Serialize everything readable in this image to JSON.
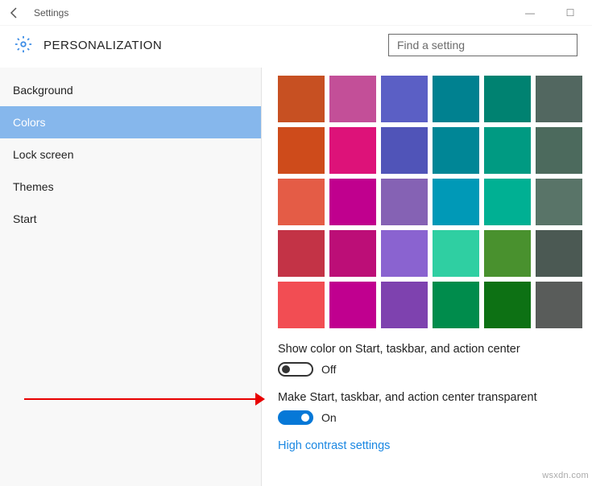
{
  "window": {
    "title": "Settings"
  },
  "header": {
    "category": "PERSONALIZATION",
    "search_placeholder": "Find a setting"
  },
  "sidebar": {
    "items": [
      {
        "label": "Background"
      },
      {
        "label": "Colors"
      },
      {
        "label": "Lock screen"
      },
      {
        "label": "Themes"
      },
      {
        "label": "Start"
      }
    ],
    "selected_index": 1
  },
  "main": {
    "colors": [
      "#c75022",
      "#c34f98",
      "#5b5fc5",
      "#008190",
      "#008271",
      "#526760",
      "#ce4b1b",
      "#dd1279",
      "#5054b8",
      "#008696",
      "#009a82",
      "#4c6a5d",
      "#e45c46",
      "#c0008e",
      "#8562b4",
      "#0099b7",
      "#00b093",
      "#597468",
      "#c33346",
      "#bc0e77",
      "#8a63d0",
      "#2fcfa2",
      "#49912e",
      "#4b5953",
      "#f24d53",
      "#c0008f",
      "#7e42af",
      "#008c4c",
      "#0d7114",
      "#595c5a"
    ],
    "setting1_label": "Show color on Start, taskbar, and action center",
    "setting1_state": "Off",
    "setting1_on": false,
    "setting2_label": "Make Start, taskbar, and action center transparent",
    "setting2_state": "On",
    "setting2_on": true,
    "link_text": "High contrast settings",
    "watermark_text": "wsxdn.com"
  }
}
